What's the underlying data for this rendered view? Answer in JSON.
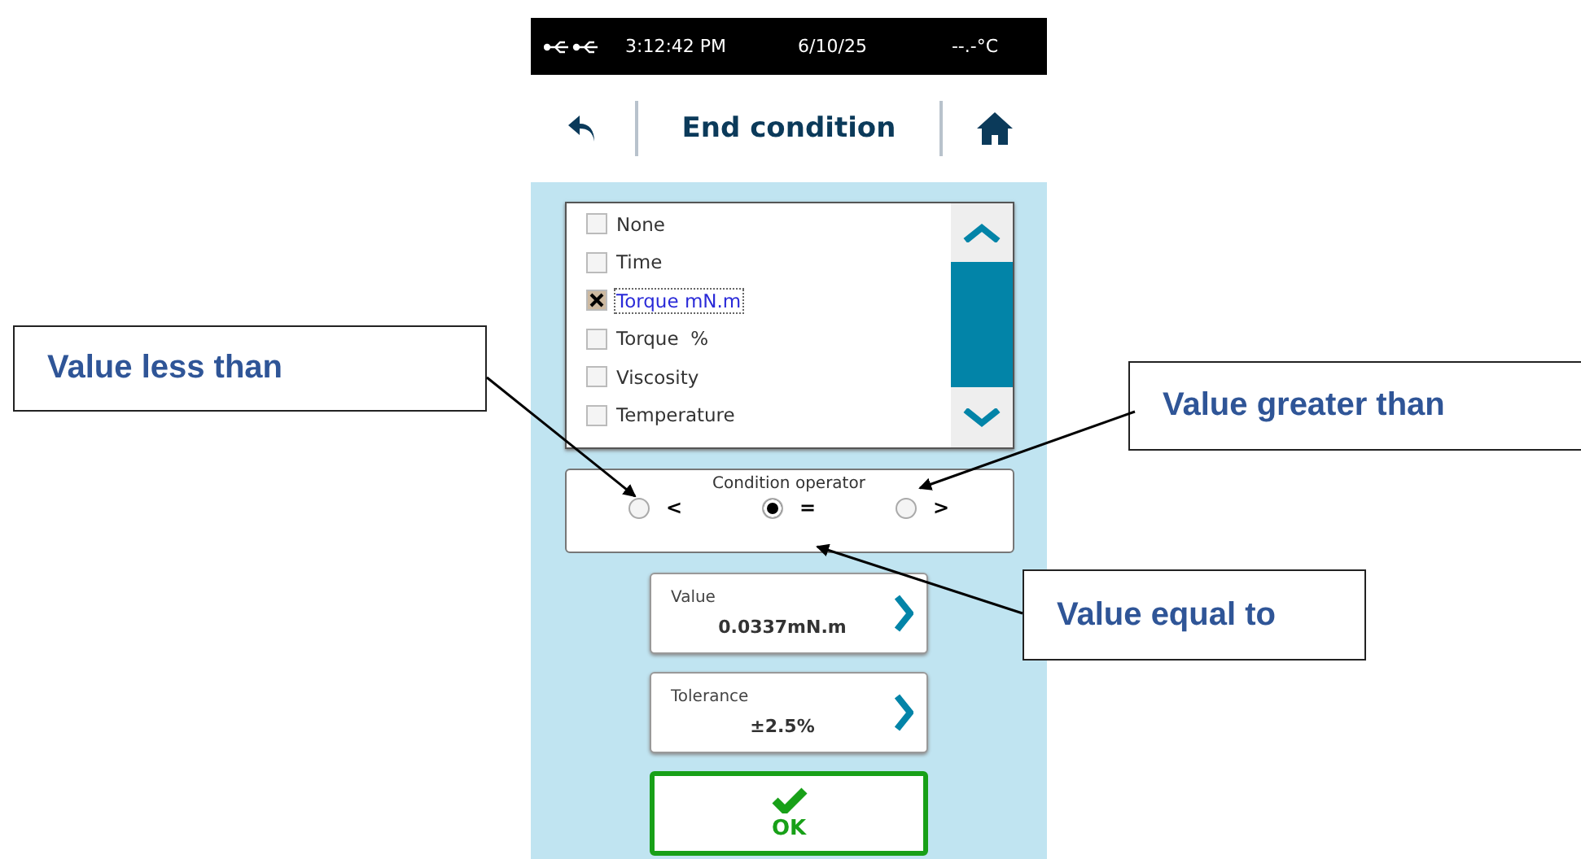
{
  "status_bar": {
    "time": "3:12:42 PM",
    "date": "6/10/25",
    "temperature": "--.-°C"
  },
  "header": {
    "title": "End condition"
  },
  "conditions": [
    {
      "label": "None",
      "checked": false,
      "selected": false
    },
    {
      "label": "Time",
      "checked": false,
      "selected": false
    },
    {
      "label": "Torque mN.m",
      "checked": true,
      "selected": true
    },
    {
      "label": "Torque  %",
      "checked": false,
      "selected": false
    },
    {
      "label": "Viscosity",
      "checked": false,
      "selected": false
    },
    {
      "label": "Temperature",
      "checked": false,
      "selected": false
    }
  ],
  "operator": {
    "label": "Condition operator",
    "options": [
      {
        "symbol": "<",
        "selected": false
      },
      {
        "symbol": "=",
        "selected": true
      },
      {
        "symbol": ">",
        "selected": false
      }
    ]
  },
  "fields": [
    {
      "label": "Value",
      "value": "0.0337mN.m"
    },
    {
      "label": "Tolerance",
      "value": "±2.5%"
    }
  ],
  "ok_button": {
    "label": "OK"
  },
  "callouts": [
    {
      "text": "Value less than"
    },
    {
      "text": "Value greater than"
    },
    {
      "text": "Value equal to"
    }
  ]
}
